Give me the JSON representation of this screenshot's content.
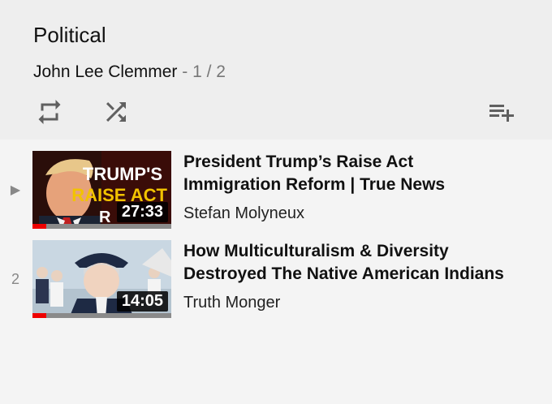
{
  "playlist": {
    "title": "Political",
    "owner": "John Lee Clemmer",
    "separator": "-",
    "position": "1 / 2"
  },
  "controls": {
    "loop_icon": "loop-icon",
    "shuffle_icon": "shuffle-icon",
    "add_icon": "playlist-add-icon",
    "icon_color": "#606060"
  },
  "videos": [
    {
      "index": "▶",
      "title_line1": "President Trump’s Raise Act",
      "title_line2": "Immigration Reform | True News",
      "channel": "Stefan Molyneux",
      "duration": "27:33",
      "thumb_text1": "TRUMP'S",
      "thumb_text2": "RAISE ACT",
      "thumb_text3": "R",
      "progress_fraction": 0.1
    },
    {
      "index": "2",
      "title_line1": "How Multiculturalism & Diversity",
      "title_line2": "Destroyed The Native American Indians",
      "channel": "Truth Monger",
      "duration": "14:05",
      "progress_fraction": 0.1
    }
  ],
  "colors": {
    "header_bg": "#eeeeee",
    "list_bg": "#f4f4f4",
    "progress_red": "#ee0000"
  }
}
